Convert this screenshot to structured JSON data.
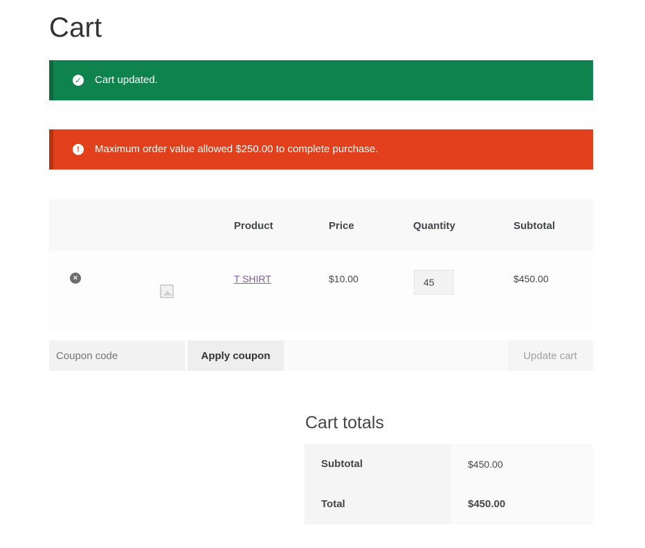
{
  "page": {
    "title": "Cart"
  },
  "notices": {
    "success": {
      "icon": "check-circle-icon",
      "text": "Cart updated.",
      "color": "#0f834d"
    },
    "error": {
      "icon": "exclamation-circle-icon",
      "text": "Maximum order value allowed $250.00 to complete purchase.",
      "color": "#e2401c"
    }
  },
  "cart_table": {
    "headers": {
      "product": "Product",
      "price": "Price",
      "quantity": "Quantity",
      "subtotal": "Subtotal"
    },
    "items": [
      {
        "remove_icon": "remove-circle-icon",
        "thumbnail_icon": "image-placeholder-icon",
        "product": "T SHIRT",
        "price": "$10.00",
        "quantity": "45",
        "subtotal": "$450.00"
      }
    ]
  },
  "actions": {
    "coupon_placeholder": "Coupon code",
    "apply_coupon_label": "Apply coupon",
    "update_cart_label": "Update cart"
  },
  "cart_totals": {
    "title": "Cart totals",
    "rows": [
      {
        "label": "Subtotal",
        "value": "$450.00"
      },
      {
        "label": "Total",
        "value": "$450.00"
      }
    ]
  },
  "colors": {
    "link": "#7f54b3",
    "success": "#0f834d",
    "error": "#e2401c"
  }
}
